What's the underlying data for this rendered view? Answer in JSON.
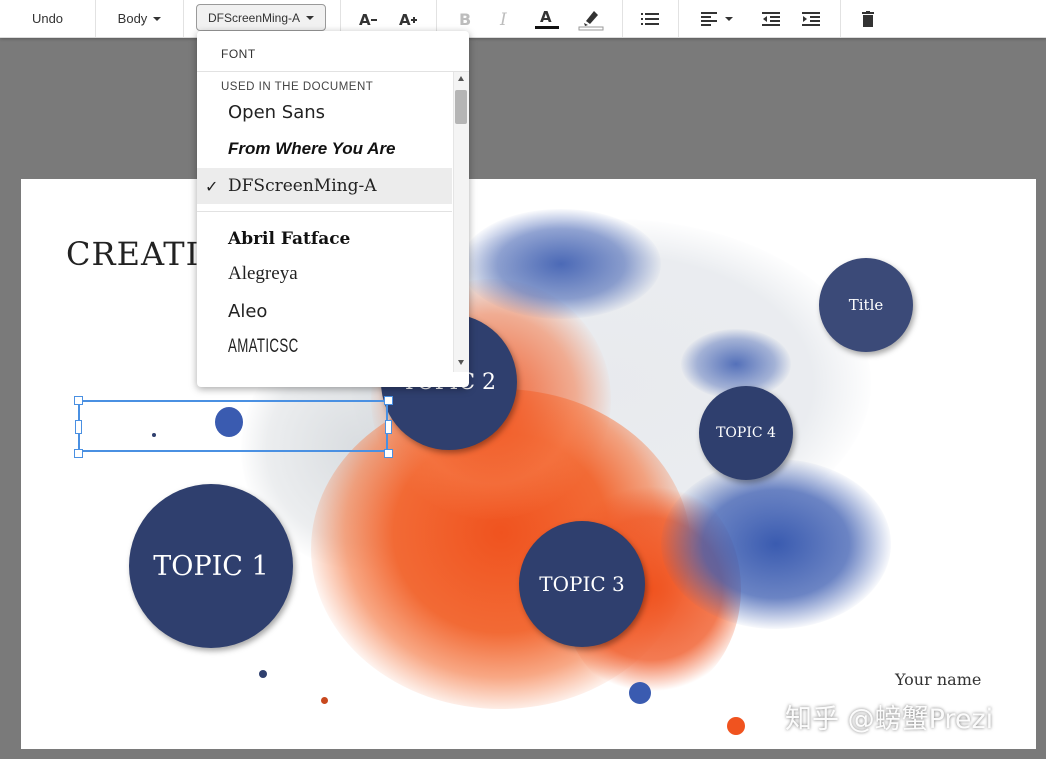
{
  "toolbar": {
    "undo": "Undo",
    "style": "Body",
    "font": "DFScreenMing-A",
    "decrease_font_icon": "font-size-decrease-icon",
    "increase_font_icon": "font-size-increase-icon"
  },
  "dropdown": {
    "header": "FONT",
    "section": "USED IN THE DOCUMENT",
    "used_fonts": [
      "Open Sans",
      "From Where You Are",
      "DFScreenMing-A"
    ],
    "other_fonts": [
      "Abril Fatface",
      "Alegreya",
      "Aleo",
      "AMATICSC"
    ],
    "selected": "DFScreenMing-A",
    "check": "✓"
  },
  "slide": {
    "title_partial": "CREATI",
    "title_circle": "Title",
    "topics": [
      "TOPIC 1",
      "TOPIC 2",
      "TOPIC 3",
      "TOPIC 4"
    ],
    "author": "Your name",
    "watermark": "知乎 @螃蟹Prezi"
  },
  "colors": {
    "navy": "#2f3f6e",
    "orange": "#f0531f",
    "blue": "#3a5bb0"
  }
}
